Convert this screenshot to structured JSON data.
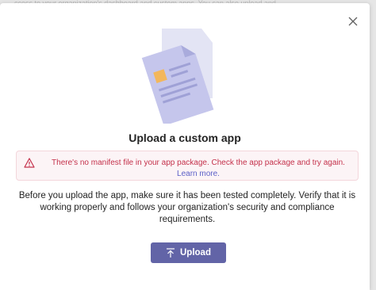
{
  "background": {
    "snippet": "ccess to your organization's dashboard and custom apps. You can also upload and"
  },
  "dialog": {
    "close_icon": "close-icon",
    "illustration_icon": "document-illustration",
    "title": "Upload a custom app",
    "error": {
      "icon": "warning-icon",
      "message": "There's no manifest file in your app package. Check the app package and try again.",
      "link": "Learn more."
    },
    "description": "Before you upload the app, make sure it has been tested completely. Verify that it is working properly and follows your organization's security and compliance requirements.",
    "upload_button": {
      "icon": "upload-icon",
      "label": "Upload"
    }
  },
  "colors": {
    "accent": "#6264a7",
    "error_text": "#c4314b",
    "error_bg": "#fcf4f6",
    "link": "#5b5fc7"
  }
}
